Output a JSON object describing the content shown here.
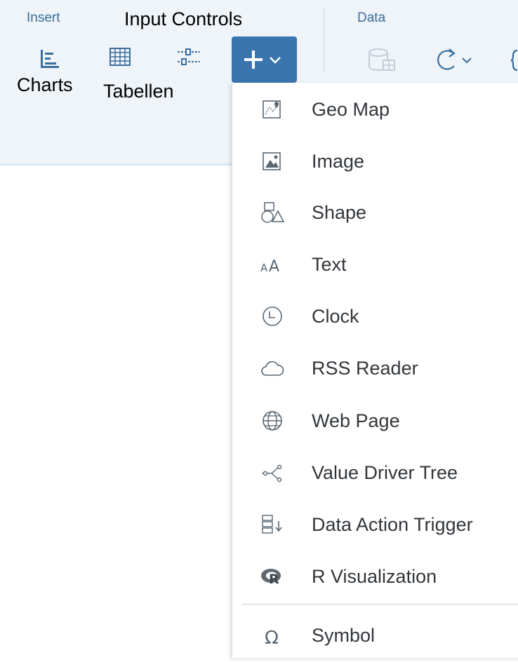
{
  "toolbar": {
    "insert_label": "Insert",
    "data_label": "Data",
    "annotations": {
      "input_controls": "Input Controls",
      "charts": "Charts",
      "tables": "Tabellen"
    }
  },
  "add_menu": {
    "items": [
      {
        "label": "Geo Map",
        "icon": "geo-map-icon"
      },
      {
        "label": "Image",
        "icon": "image-icon"
      },
      {
        "label": "Shape",
        "icon": "shape-icon"
      },
      {
        "label": "Text",
        "icon": "text-icon"
      },
      {
        "label": "Clock",
        "icon": "clock-icon"
      },
      {
        "label": "RSS Reader",
        "icon": "cloud-icon"
      },
      {
        "label": "Web Page",
        "icon": "globe-icon"
      },
      {
        "label": "Value Driver Tree",
        "icon": "tree-icon"
      },
      {
        "label": "Data Action Trigger",
        "icon": "data-action-icon"
      },
      {
        "label": "R Visualization",
        "icon": "r-logo-icon"
      },
      {
        "label": "Symbol",
        "icon": "omega-icon"
      }
    ]
  },
  "colors": {
    "toolbar_bg": "#eff4f9",
    "accent": "#3b75ad",
    "icon_blue": "#3a6d9c",
    "menu_text": "#32363a"
  }
}
